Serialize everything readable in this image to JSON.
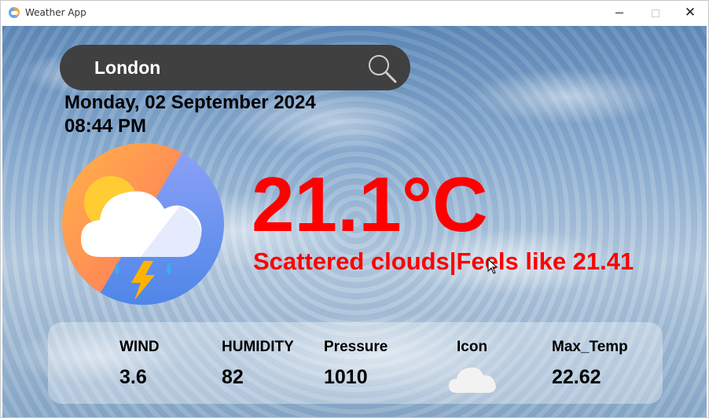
{
  "window": {
    "title": "Weather App",
    "close_glyph": "✕"
  },
  "search": {
    "value": "London",
    "icon": "search-icon"
  },
  "datetime": {
    "date": "Monday, 02 September 2024",
    "time": "08:44 PM"
  },
  "current": {
    "temperature": "21.1°C",
    "description": "Scattered clouds|Feels like 21.41",
    "icon": "thunderstorm-cloud-sun-icon"
  },
  "details": {
    "wind_label": "WIND",
    "wind_value": "3.6",
    "humidity_label": "HUMIDITY",
    "humidity_value": "82",
    "pressure_label": "Pressure",
    "pressure_value": "1010",
    "icon_label": "Icon",
    "icon_name": "cloud-icon",
    "max_temp_label": "Max_Temp",
    "max_temp_value": "22.62"
  },
  "colors": {
    "temperature": "#ff0000",
    "search_bar": "#404040"
  }
}
